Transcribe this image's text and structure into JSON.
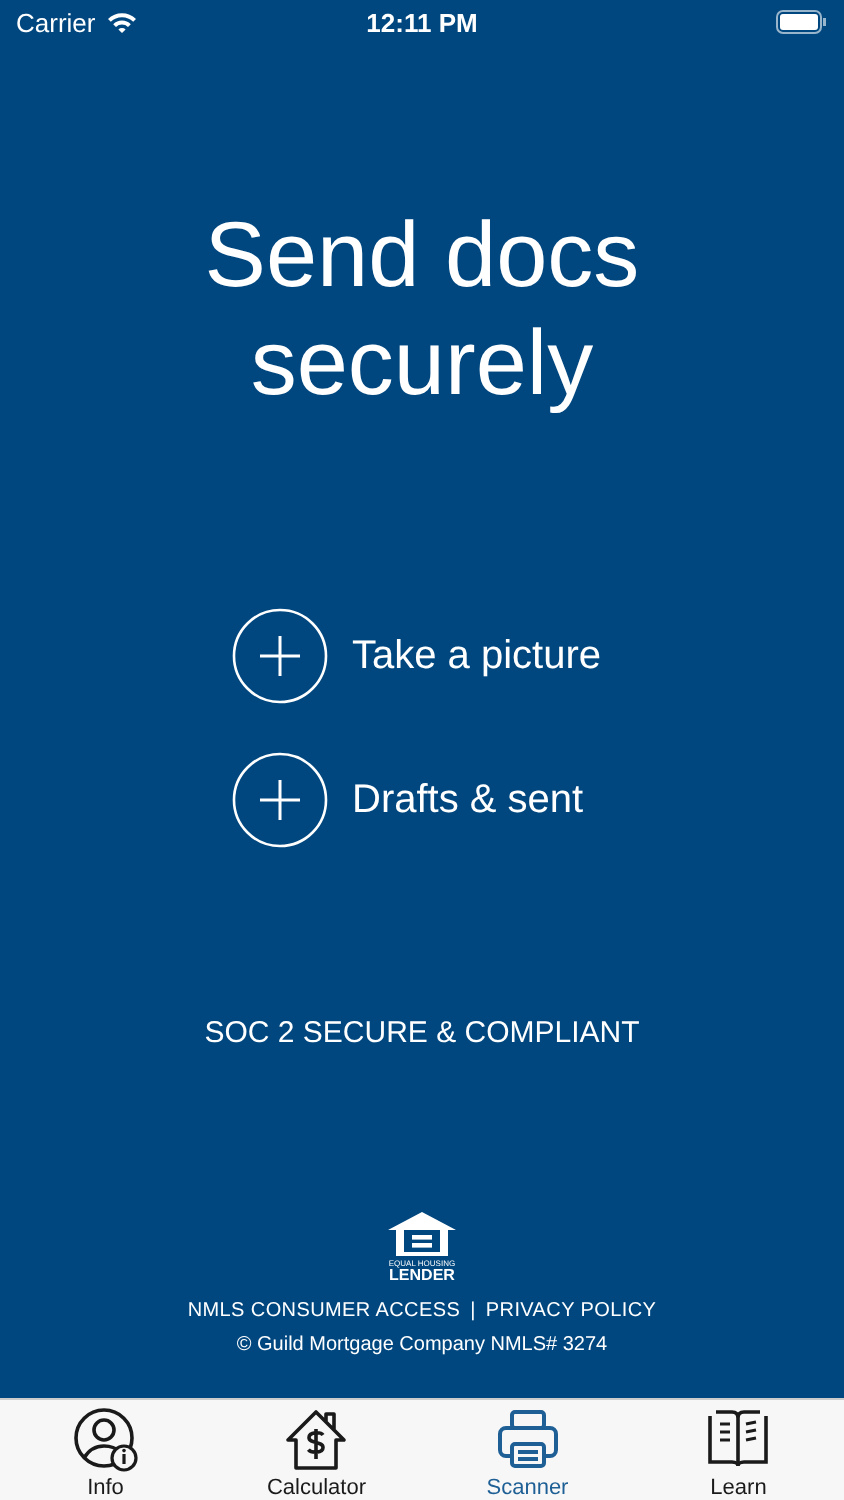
{
  "status_bar": {
    "carrier": "Carrier",
    "time": "12:11 PM"
  },
  "title": "Send docs securely",
  "actions": [
    {
      "label": "Take a picture"
    },
    {
      "label": "Drafts & sent"
    }
  ],
  "security_note": "SOC 2 SECURE & COMPLIANT",
  "logo": {
    "top_text": "EQUAL HOUSING",
    "bottom_text": "LENDER"
  },
  "links": [
    "NMLS CONSUMER ACCESS",
    "PRIVACY POLICY"
  ],
  "separator": "|",
  "copyright": "© Guild Mortgage Company NMLS# 3274",
  "tabs": [
    {
      "label": "Info",
      "kind": "info",
      "selected": false
    },
    {
      "label": "Calculator",
      "kind": "calculator",
      "selected": false
    },
    {
      "label": "Scanner",
      "kind": "scanner",
      "selected": true
    },
    {
      "label": "Learn",
      "kind": "learn",
      "selected": false
    }
  ]
}
